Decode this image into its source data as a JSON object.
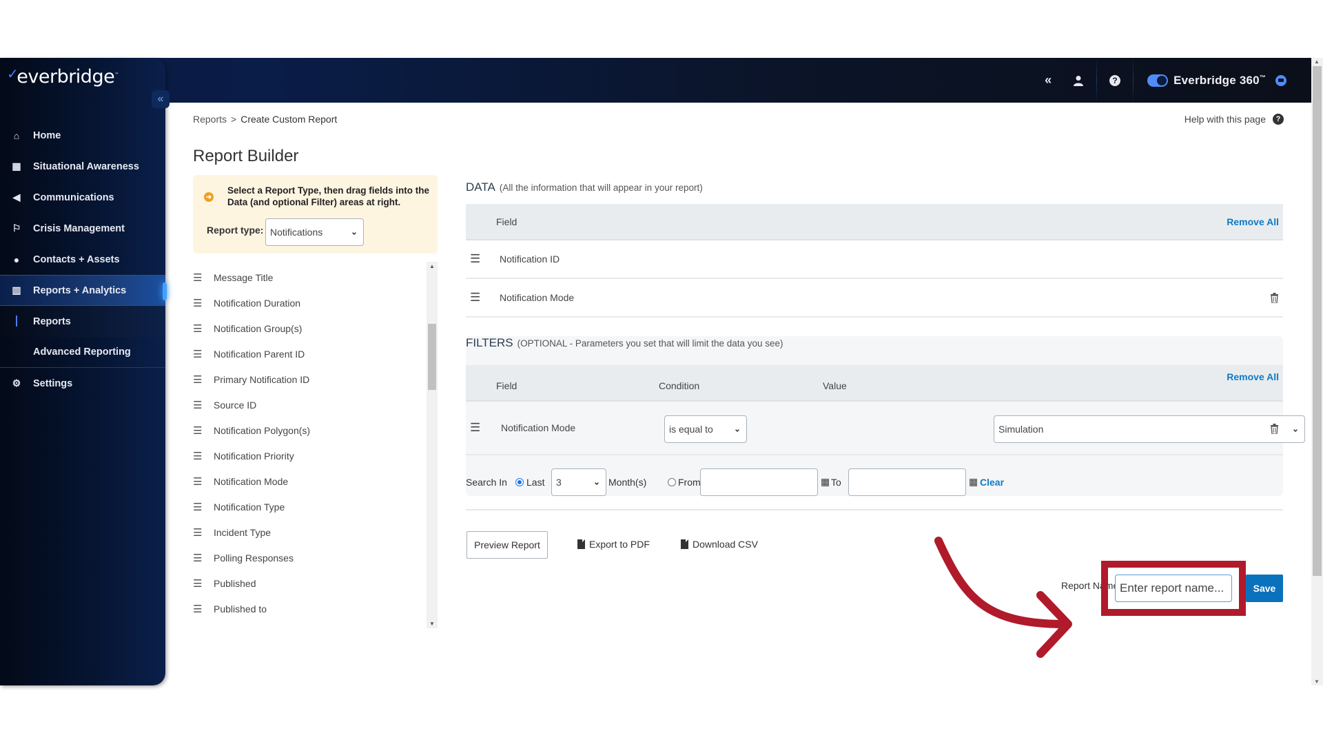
{
  "app": {
    "brand": "everbridge",
    "product": "Everbridge 360",
    "trademark": "™"
  },
  "topbar": {
    "collapse_icon": "double-chevron-left-icon",
    "user_icon": "user-icon",
    "help_icon": "question-circle-icon",
    "toggle_on": true,
    "chat_icon": "chat-icon"
  },
  "sidebar": {
    "items": [
      {
        "label": "Home",
        "icon": "home-icon"
      },
      {
        "label": "Situational Awareness",
        "icon": "map-icon"
      },
      {
        "label": "Communications",
        "icon": "megaphone-icon"
      },
      {
        "label": "Crisis Management",
        "icon": "crisis-icon"
      },
      {
        "label": "Contacts + Assets",
        "icon": "location-pin-icon"
      },
      {
        "label": "Reports + Analytics",
        "icon": "bar-chart-icon",
        "active": true
      },
      {
        "label": "Settings",
        "icon": "gear-icon"
      }
    ],
    "sub_items": [
      {
        "label": "Reports",
        "current": true
      },
      {
        "label": "Advanced Reporting"
      }
    ]
  },
  "breadcrumb": {
    "parent": "Reports",
    "separator": ">",
    "current": "Create Custom Report"
  },
  "help_link": "Help with this page",
  "page_title": "Report Builder",
  "notice": {
    "message": "Select a Report Type, then drag fields into the Data (and optional Filter) areas at right.",
    "report_type_label": "Report type:",
    "report_type_value": "Notifications"
  },
  "field_list": [
    "Message Title",
    "Notification Duration",
    "Notification Group(s)",
    "Notification Parent ID",
    "Primary Notification ID",
    "Source ID",
    "Notification Polygon(s)",
    "Notification Priority",
    "Notification Mode",
    "Notification Type",
    "Incident Type",
    "Polling Responses",
    "Published",
    "Published to"
  ],
  "data_section": {
    "title": "DATA",
    "subtitle": "(All the information that will appear in your report)",
    "column_field": "Field",
    "remove_all": "Remove All",
    "rows": [
      "Notification ID",
      "Notification Mode"
    ]
  },
  "filters_section": {
    "title": "FILTERS",
    "subtitle": "(OPTIONAL - Parameters you set that will limit the data you see)",
    "columns": {
      "field": "Field",
      "condition": "Condition",
      "value": "Value"
    },
    "remove_all": "Remove All",
    "rows": [
      {
        "field": "Notification Mode",
        "condition": "is equal to",
        "value": "Simulation"
      }
    ],
    "search": {
      "label": "Search In",
      "last_label": "Last",
      "last_selected": true,
      "last_value": "3",
      "months_label": "Month(s)",
      "from_label": "From",
      "from_value": "",
      "to_label": "To",
      "to_value": "",
      "clear_label": "Clear"
    }
  },
  "actions": {
    "preview": "Preview Report",
    "export_pdf": "Export to PDF",
    "download_csv": "Download CSV",
    "report_name_label": "Report Name",
    "report_name_placeholder": "Enter report name...",
    "save": "Save"
  },
  "annotation": {
    "color": "#b01a2a",
    "target": "report-name-input"
  }
}
